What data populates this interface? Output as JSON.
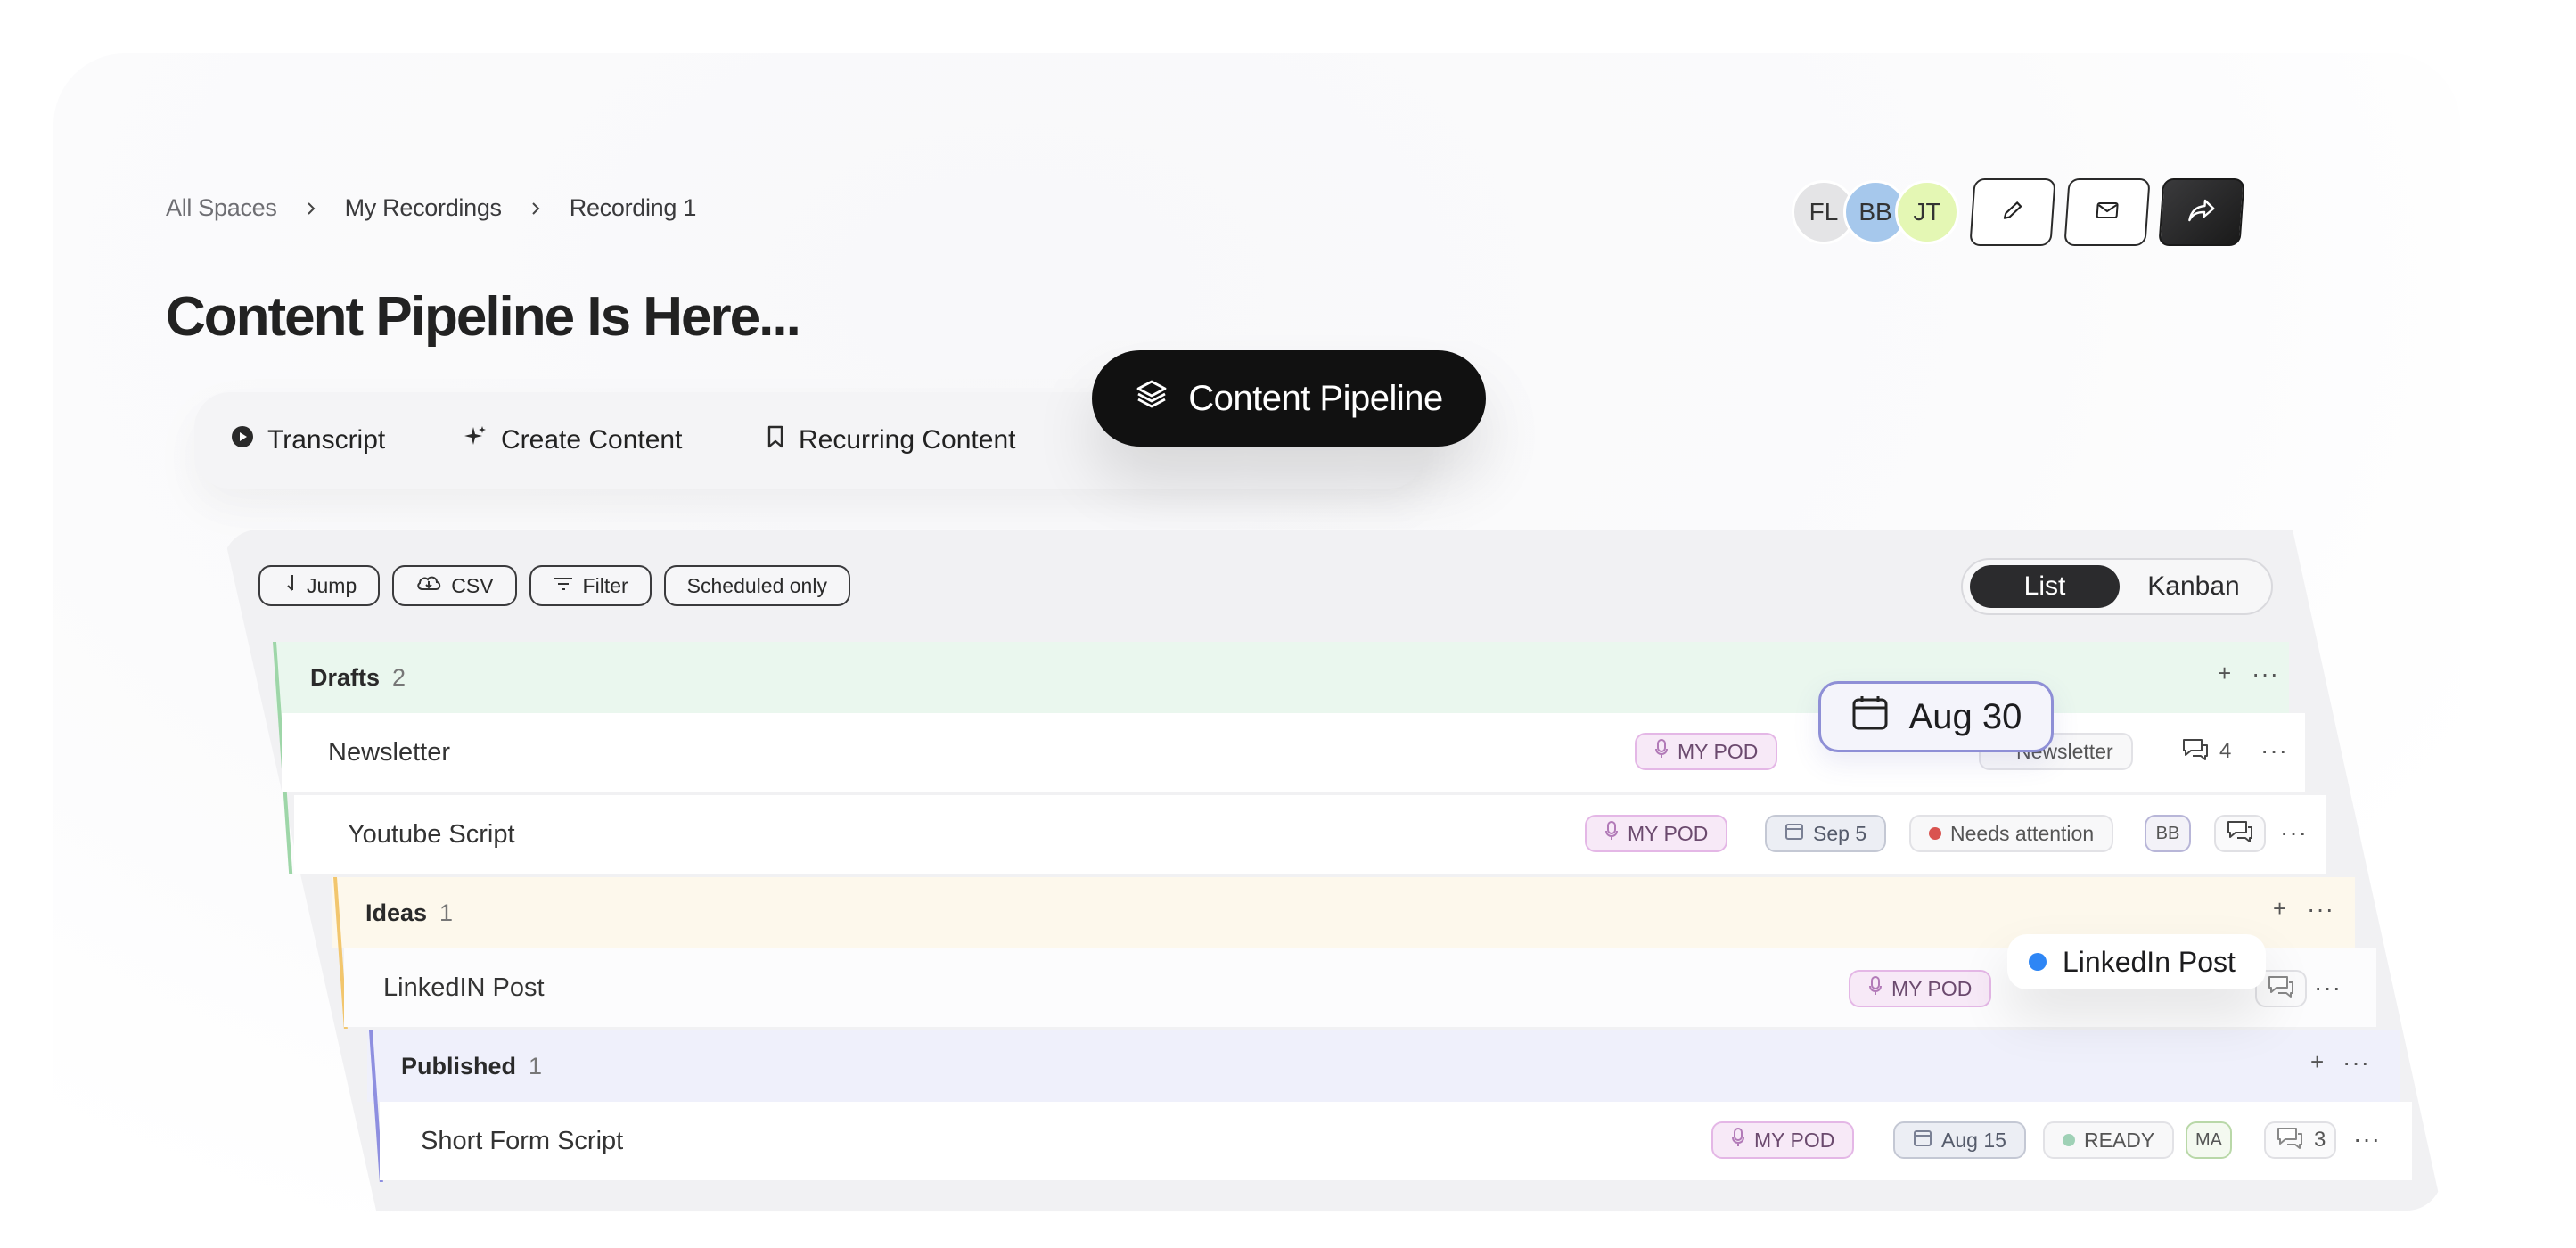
{
  "breadcrumb": [
    "All Spaces",
    "My Recordings",
    "Recording 1"
  ],
  "page_title": "Content Pipeline Is Here...",
  "collaborators": [
    "FL",
    "BB",
    "JT"
  ],
  "header_actions": {
    "icons": [
      "pencil-icon",
      "mail-icon",
      "share-icon"
    ]
  },
  "tabs": {
    "transcript": "Transcript",
    "create_content": "Create Content",
    "recurring_content": "Recurring Content",
    "content_pipeline": "Content Pipeline"
  },
  "toolbar": {
    "jump": "Jump",
    "csv": "CSV",
    "filter": "Filter",
    "scheduled_only": "Scheduled only"
  },
  "view_toggle": {
    "list": "List",
    "kanban": "Kanban",
    "selected": "List"
  },
  "groups": {
    "drafts": {
      "title": "Drafts",
      "count": "2",
      "color": "#9ed6a8"
    },
    "ideas": {
      "title": "Ideas",
      "count": "1",
      "color": "#f2c66d"
    },
    "published": {
      "title": "Published",
      "count": "1",
      "color": "#8e8fe0"
    }
  },
  "items": {
    "newsletter": {
      "title": "Newsletter",
      "pod": "MY POD",
      "tag": "Newsletter",
      "comments": "4"
    },
    "youtube": {
      "title": "Youtube Script",
      "pod": "MY POD",
      "date": "Sep 5",
      "status": "Needs attention",
      "assignee": "BB"
    },
    "linkedin": {
      "title": "LinkedIN Post",
      "pod": "MY POD"
    },
    "short_form": {
      "title": "Short Form Script",
      "pod": "MY POD",
      "date": "Aug 15",
      "status": "READY",
      "assignee": "MA",
      "comments": "3"
    }
  },
  "floating": {
    "date": "Aug 30",
    "linkedin": "LinkedIn Post"
  },
  "more_glyph": "···",
  "plus_glyph": "+"
}
